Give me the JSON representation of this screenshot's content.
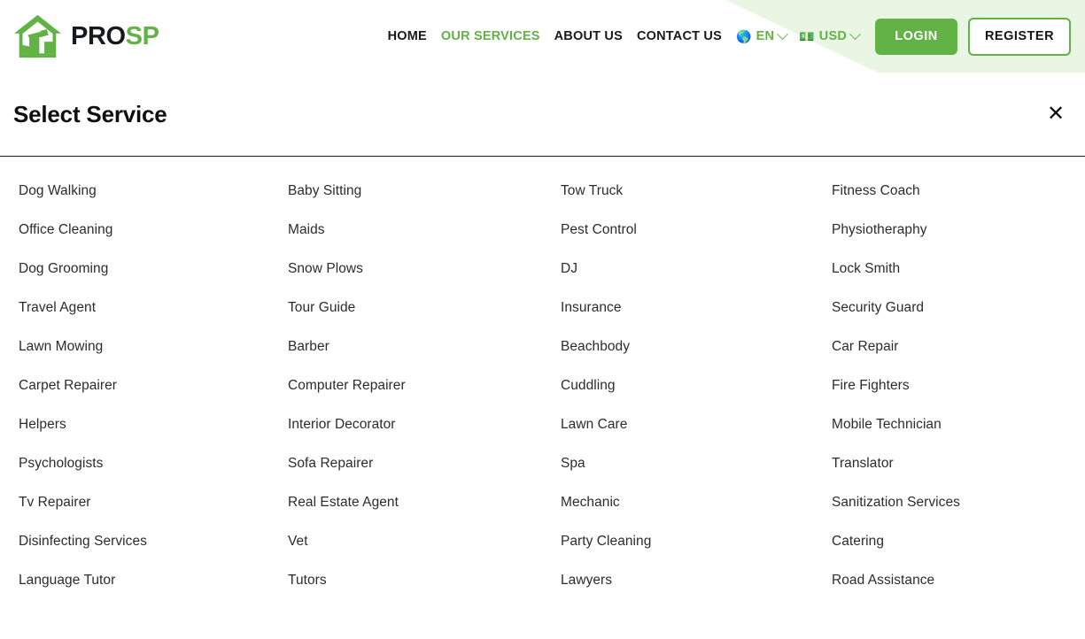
{
  "brand": {
    "logo_icon": "house-tool-icon",
    "name_part1": "PRO",
    "name_part2": "SP",
    "accent_color": "#62b246",
    "dark_color": "#18191a"
  },
  "nav": {
    "links": [
      {
        "label": "HOME",
        "active": false
      },
      {
        "label": "OUR SERVICES",
        "active": true
      },
      {
        "label": "ABOUT US",
        "active": false
      },
      {
        "label": "CONTACT US",
        "active": false
      }
    ],
    "language": {
      "icon": "globe-icon",
      "emoji": "🌎",
      "label": "EN",
      "chevron": "chevron-down-icon"
    },
    "currency": {
      "icon": "banknote-icon",
      "emoji": "💵",
      "label": "USD",
      "chevron": "chevron-down-icon"
    },
    "login_label": "LOGIN",
    "register_label": "REGISTER"
  },
  "modal": {
    "title": "Select Service",
    "close_icon": "close-icon",
    "close_glyph": "✕"
  },
  "services": {
    "columns": [
      {
        "items": [
          "Dog Walking",
          "Office Cleaning",
          "Dog Grooming",
          "Travel Agent",
          "Lawn Mowing",
          "Carpet Repairer",
          "Helpers",
          "Psychologists",
          "Tv Repairer",
          "Disinfecting Services",
          "Language Tutor"
        ]
      },
      {
        "items": [
          "Baby Sitting",
          "Maids",
          "Snow Plows",
          "Tour Guide",
          "Barber",
          "Computer Repairer",
          "Interior Decorator",
          "Sofa Repairer",
          "Real Estate Agent",
          "Vet",
          "Tutors"
        ]
      },
      {
        "items": [
          "Tow Truck",
          "Pest Control",
          "DJ",
          "Insurance",
          "Beachbody",
          "Cuddling",
          "Lawn Care",
          "Spa",
          "Mechanic",
          "Party Cleaning",
          "Lawyers"
        ]
      },
      {
        "items": [
          "Fitness Coach",
          "Physiotheraphy",
          "Lock Smith",
          "Security Guard",
          "Car Repair",
          "Fire Fighters",
          "Mobile Technician",
          "Translator",
          "Sanitization Services",
          "Catering",
          "Road Assistance"
        ]
      }
    ]
  }
}
